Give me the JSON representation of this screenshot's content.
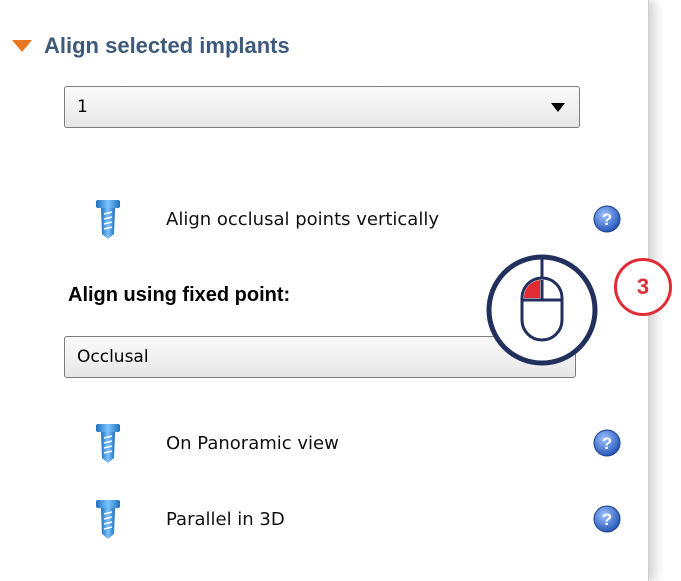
{
  "section": {
    "title": "Align selected implants"
  },
  "selector1": {
    "value": "1"
  },
  "actions": {
    "align_vertical": "Align occlusal points vertically",
    "on_panoramic": "On Panoramic view",
    "parallel_3d": "Parallel in 3D"
  },
  "fixed_point": {
    "label": "Align using fixed point:",
    "selected": "Occlusal"
  },
  "annotation": {
    "step": "3",
    "icon": "mouse-left-click-icon",
    "color": "#e12b35"
  },
  "icons": {
    "section_toggle": "triangle-down-icon",
    "implant": "implant-icon",
    "help": "help-icon"
  },
  "colors": {
    "section_title": "#3e5a7a",
    "toggle": "#e8761e",
    "help": "#2d5fc4",
    "implant": "#3a8fd9"
  }
}
